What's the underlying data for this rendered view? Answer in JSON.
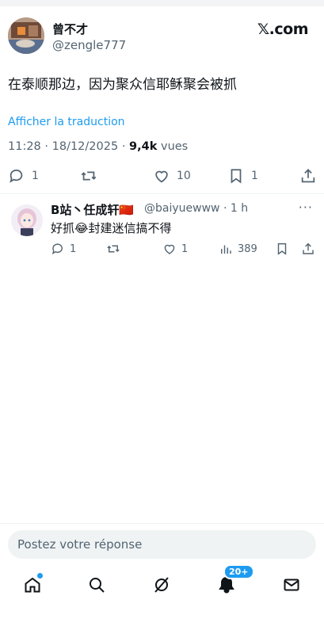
{
  "brand": "𝕏.com",
  "author": {
    "name": "曾不才",
    "handle": "@zengle777"
  },
  "tweet": {
    "text": "在泰顺那边，因为聚众信耶稣聚会被抓",
    "translate_label": "Afficher la traduction",
    "time": "11:28",
    "date": "18/12/2025",
    "views_count": "9,4k",
    "views_label": "vues"
  },
  "actions": {
    "reply_count": "1",
    "repost_count": "",
    "like_count": "10",
    "bookmark_count": "1"
  },
  "reply": {
    "name": "B站丶任成轩🇨🇳",
    "handle": "@baiyuewww",
    "time": "· 1 h",
    "text": "好抓😂封建迷信搞不得",
    "reply_count": "1",
    "like_count": "1",
    "view_count": "389"
  },
  "composer": {
    "placeholder": "Postez votre réponse"
  },
  "tabbar": {
    "notifications_badge": "20+"
  },
  "colors": {
    "accent": "#1d9bf0",
    "text": "#0f1419",
    "muted": "#536471"
  }
}
